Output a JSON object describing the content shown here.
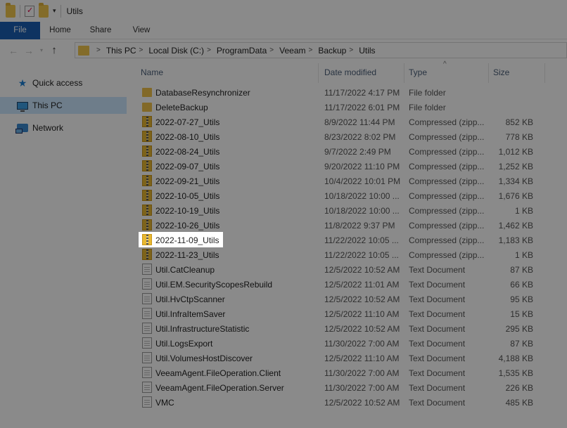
{
  "window": {
    "title": "Utils",
    "quick_access_dropdown": "▾"
  },
  "ribbon": {
    "tabs": [
      "File",
      "Home",
      "Share",
      "View"
    ]
  },
  "navigation": {
    "back": "←",
    "forward": "→",
    "recent_dropdown": "▾",
    "up": "↑"
  },
  "address": {
    "crumbs": [
      "This PC",
      "Local Disk (C:)",
      "ProgramData",
      "Veeam",
      "Backup",
      "Utils"
    ],
    "separator": ">"
  },
  "sidebar": {
    "items": [
      {
        "label": "Quick access",
        "icon": "star-icon"
      },
      {
        "label": "This PC",
        "icon": "computer-icon",
        "selected": true
      },
      {
        "label": "Network",
        "icon": "network-icon"
      }
    ]
  },
  "columns": {
    "name": "Name",
    "date": "Date modified",
    "type": "Type",
    "size": "Size",
    "sort_indicator": "^"
  },
  "files": [
    {
      "name": "DatabaseResynchronizer",
      "date": "11/17/2022 4:17 PM",
      "type": "File folder",
      "size": "",
      "kind": "folder"
    },
    {
      "name": "DeleteBackup",
      "date": "11/17/2022 6:01 PM",
      "type": "File folder",
      "size": "",
      "kind": "folder"
    },
    {
      "name": "2022-07-27_Utils",
      "date": "8/9/2022 11:44 PM",
      "type": "Compressed (zipp...",
      "size": "852 KB",
      "kind": "zip"
    },
    {
      "name": "2022-08-10_Utils",
      "date": "8/23/2022 8:02 PM",
      "type": "Compressed (zipp...",
      "size": "778 KB",
      "kind": "zip"
    },
    {
      "name": "2022-08-24_Utils",
      "date": "9/7/2022 2:49 PM",
      "type": "Compressed (zipp...",
      "size": "1,012 KB",
      "kind": "zip"
    },
    {
      "name": "2022-09-07_Utils",
      "date": "9/20/2022 11:10 PM",
      "type": "Compressed (zipp...",
      "size": "1,252 KB",
      "kind": "zip"
    },
    {
      "name": "2022-09-21_Utils",
      "date": "10/4/2022 10:01 PM",
      "type": "Compressed (zipp...",
      "size": "1,334 KB",
      "kind": "zip"
    },
    {
      "name": "2022-10-05_Utils",
      "date": "10/18/2022 10:00 ...",
      "type": "Compressed (zipp...",
      "size": "1,676 KB",
      "kind": "zip"
    },
    {
      "name": "2022-10-19_Utils",
      "date": "10/18/2022 10:00 ...",
      "type": "Compressed (zipp...",
      "size": "1 KB",
      "kind": "zip"
    },
    {
      "name": "2022-10-26_Utils",
      "date": "11/8/2022 9:37 PM",
      "type": "Compressed (zipp...",
      "size": "1,462 KB",
      "kind": "zip"
    },
    {
      "name": "2022-11-09_Utils",
      "date": "11/22/2022 10:05 ...",
      "type": "Compressed (zipp...",
      "size": "1,183 KB",
      "kind": "zip",
      "highlighted": true
    },
    {
      "name": "2022-11-23_Utils",
      "date": "11/22/2022 10:05 ...",
      "type": "Compressed (zipp...",
      "size": "1 KB",
      "kind": "zip"
    },
    {
      "name": "Util.CatCleanup",
      "date": "12/5/2022 10:52 AM",
      "type": "Text Document",
      "size": "87 KB",
      "kind": "txt"
    },
    {
      "name": "Util.EM.SecurityScopesRebuild",
      "date": "12/5/2022 11:01 AM",
      "type": "Text Document",
      "size": "66 KB",
      "kind": "txt"
    },
    {
      "name": "Util.HvCtpScanner",
      "date": "12/5/2022 10:52 AM",
      "type": "Text Document",
      "size": "95 KB",
      "kind": "txt"
    },
    {
      "name": "Util.InfraItemSaver",
      "date": "12/5/2022 11:10 AM",
      "type": "Text Document",
      "size": "15 KB",
      "kind": "txt"
    },
    {
      "name": "Util.InfrastructureStatistic",
      "date": "12/5/2022 10:52 AM",
      "type": "Text Document",
      "size": "295 KB",
      "kind": "txt"
    },
    {
      "name": "Util.LogsExport",
      "date": "11/30/2022 7:00 AM",
      "type": "Text Document",
      "size": "87 KB",
      "kind": "txt"
    },
    {
      "name": "Util.VolumesHostDiscover",
      "date": "12/5/2022 11:10 AM",
      "type": "Text Document",
      "size": "4,188 KB",
      "kind": "txt"
    },
    {
      "name": "VeeamAgent.FileOperation.Client",
      "date": "11/30/2022 7:00 AM",
      "type": "Text Document",
      "size": "1,535 KB",
      "kind": "txt"
    },
    {
      "name": "VeeamAgent.FileOperation.Server",
      "date": "11/30/2022 7:00 AM",
      "type": "Text Document",
      "size": "226 KB",
      "kind": "txt"
    },
    {
      "name": "VMC",
      "date": "12/5/2022 10:52 AM",
      "type": "Text Document",
      "size": "485 KB",
      "kind": "txt"
    }
  ],
  "colors": {
    "file_tab": "#1a5fb4",
    "selected_nav": "#cce8ff",
    "folder": "#f0c24a",
    "header_text": "#4c607a",
    "dim_overlay": "rgba(0,0,0,0.46)"
  }
}
